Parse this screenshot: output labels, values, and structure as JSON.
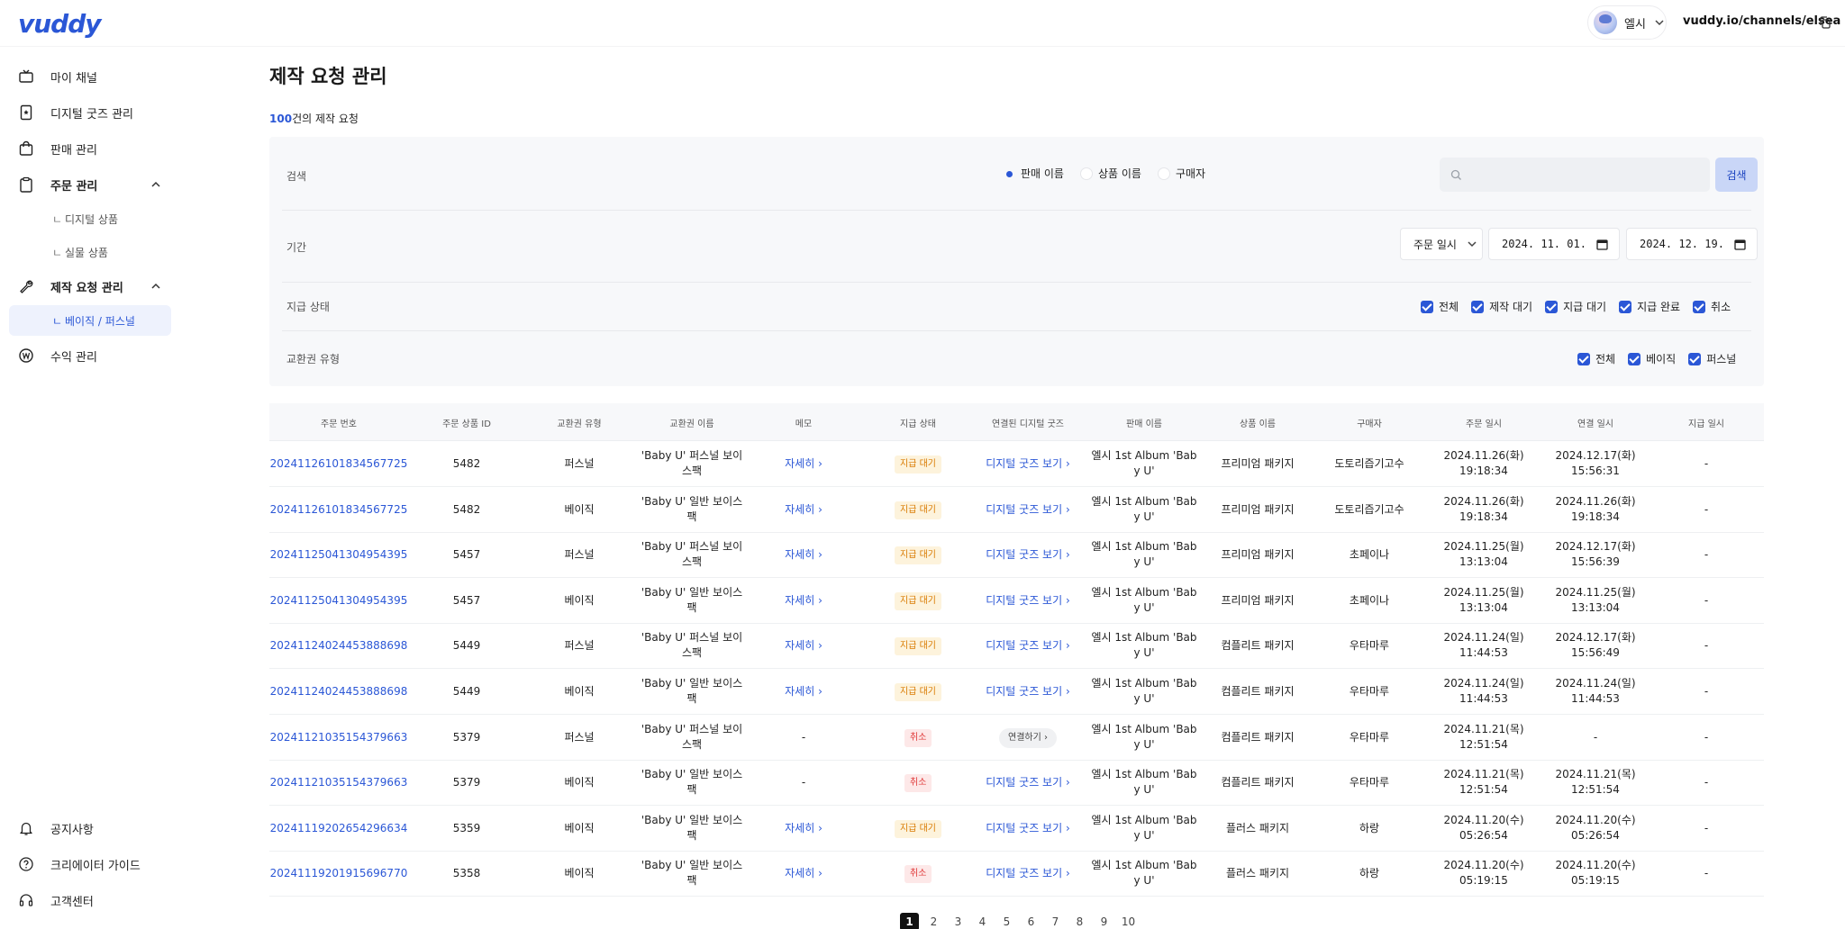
{
  "header": {
    "logo": "vuddy",
    "user_name": "엘시",
    "channel_url": "vuddy.io/channels/elsea"
  },
  "sidebar": {
    "items": [
      {
        "label": "마이 채널",
        "icon": "tv-icon"
      },
      {
        "label": "디지털 굿즈 관리",
        "icon": "digital-goods-icon"
      },
      {
        "label": "판매 관리",
        "icon": "shopping-bag-icon"
      },
      {
        "label": "주문 관리",
        "icon": "clipboard-icon"
      },
      {
        "label": "제작 요청 관리",
        "icon": "wrench-icon"
      },
      {
        "label": "수익 관리",
        "icon": "won-coin-icon"
      }
    ],
    "order_sub": [
      {
        "label": "디지털 상품"
      },
      {
        "label": "실물 상품"
      }
    ],
    "request_sub": [
      {
        "label": "베이직 / 퍼스널"
      }
    ],
    "bottom": [
      {
        "label": "공지사항",
        "icon": "bell-icon"
      },
      {
        "label": "크리에이터 가이드",
        "icon": "help-circle-icon"
      },
      {
        "label": "고객센터",
        "icon": "headset-icon"
      }
    ]
  },
  "page": {
    "title": "제작 요청 관리",
    "count_num": "100",
    "count_suffix": "건의 제작 요청"
  },
  "filters": {
    "search_label": "검색",
    "search_options": [
      "판매 이름",
      "상품 이름",
      "구매자"
    ],
    "search_selected": "판매 이름",
    "search_value": "",
    "search_button": "검색",
    "period_label": "기간",
    "period_type": "주문 일시",
    "date_from": "2024. 11. 01.",
    "date_to": "2024. 12. 19.",
    "pay_status_label": "지급 상태",
    "pay_status_options": [
      "전체",
      "제작 대기",
      "지급 대기",
      "지급 완료",
      "취소"
    ],
    "ticket_type_label": "교환권 유형",
    "ticket_type_options": [
      "전체",
      "베이직",
      "퍼스널"
    ]
  },
  "table": {
    "columns": [
      "주문 번호",
      "주문 상품 ID",
      "교환권 유형",
      "교환권 이름",
      "메모",
      "지급 상태",
      "연결된 디지털 굿즈",
      "판매 이름",
      "상품 이름",
      "구매자",
      "주문 일시",
      "연결 일시",
      "지급 일시"
    ],
    "memo_link": "자세히",
    "goods_link": "디지털 굿즈 보기",
    "connect_button": "연결하기",
    "rows": [
      {
        "order": "20241126101834567725",
        "pid": "5482",
        "type": "퍼스널",
        "name1": "'Baby U' 퍼스널 보이",
        "name2": "스팩",
        "memo": "link",
        "status": "지급 대기",
        "goods": "link",
        "sale1": "엘시 1st Album 'Bab",
        "sale2": "y U'",
        "product": "프리미엄 패키지",
        "buyer": "도토리즙기고수",
        "od1": "2024.11.26(화)",
        "od2": "19:18:34",
        "cd1": "2024.12.17(화)",
        "cd2": "15:56:31",
        "paid": "-"
      },
      {
        "order": "20241126101834567725",
        "pid": "5482",
        "type": "베이직",
        "name1": "'Baby U' 일반 보이스",
        "name2": "팩",
        "memo": "link",
        "status": "지급 대기",
        "goods": "link",
        "sale1": "엘시 1st Album 'Bab",
        "sale2": "y U'",
        "product": "프리미엄 패키지",
        "buyer": "도토리즙기고수",
        "od1": "2024.11.26(화)",
        "od2": "19:18:34",
        "cd1": "2024.11.26(화)",
        "cd2": "19:18:34",
        "paid": "-"
      },
      {
        "order": "20241125041304954395",
        "pid": "5457",
        "type": "퍼스널",
        "name1": "'Baby U' 퍼스널 보이",
        "name2": "스팩",
        "memo": "link",
        "status": "지급 대기",
        "goods": "link",
        "sale1": "엘시 1st Album 'Bab",
        "sale2": "y U'",
        "product": "프리미엄 패키지",
        "buyer": "초페이나",
        "od1": "2024.11.25(월)",
        "od2": "13:13:04",
        "cd1": "2024.12.17(화)",
        "cd2": "15:56:39",
        "paid": "-"
      },
      {
        "order": "20241125041304954395",
        "pid": "5457",
        "type": "베이직",
        "name1": "'Baby U' 일반 보이스",
        "name2": "팩",
        "memo": "link",
        "status": "지급 대기",
        "goods": "link",
        "sale1": "엘시 1st Album 'Bab",
        "sale2": "y U'",
        "product": "프리미엄 패키지",
        "buyer": "초페이나",
        "od1": "2024.11.25(월)",
        "od2": "13:13:04",
        "cd1": "2024.11.25(월)",
        "cd2": "13:13:04",
        "paid": "-"
      },
      {
        "order": "20241124024453888698",
        "pid": "5449",
        "type": "퍼스널",
        "name1": "'Baby U' 퍼스널 보이",
        "name2": "스팩",
        "memo": "link",
        "status": "지급 대기",
        "goods": "link",
        "sale1": "엘시 1st Album 'Bab",
        "sale2": "y U'",
        "product": "컴플리트 패키지",
        "buyer": "우타마루",
        "od1": "2024.11.24(일)",
        "od2": "11:44:53",
        "cd1": "2024.12.17(화)",
        "cd2": "15:56:49",
        "paid": "-"
      },
      {
        "order": "20241124024453888698",
        "pid": "5449",
        "type": "베이직",
        "name1": "'Baby U' 일반 보이스",
        "name2": "팩",
        "memo": "link",
        "status": "지급 대기",
        "goods": "link",
        "sale1": "엘시 1st Album 'Bab",
        "sale2": "y U'",
        "product": "컴플리트 패키지",
        "buyer": "우타마루",
        "od1": "2024.11.24(일)",
        "od2": "11:44:53",
        "cd1": "2024.11.24(일)",
        "cd2": "11:44:53",
        "paid": "-"
      },
      {
        "order": "20241121035154379663",
        "pid": "5379",
        "type": "퍼스널",
        "name1": "'Baby U' 퍼스널 보이",
        "name2": "스팩",
        "memo": "-",
        "status": "취소",
        "goods": "connect",
        "sale1": "엘시 1st Album 'Bab",
        "sale2": "y U'",
        "product": "컴플리트 패키지",
        "buyer": "우타마루",
        "od1": "2024.11.21(목)",
        "od2": "12:51:54",
        "cd1": "-",
        "cd2": "",
        "paid": "-"
      },
      {
        "order": "20241121035154379663",
        "pid": "5379",
        "type": "베이직",
        "name1": "'Baby U' 일반 보이스",
        "name2": "팩",
        "memo": "-",
        "status": "취소",
        "goods": "link",
        "sale1": "엘시 1st Album 'Bab",
        "sale2": "y U'",
        "product": "컴플리트 패키지",
        "buyer": "우타마루",
        "od1": "2024.11.21(목)",
        "od2": "12:51:54",
        "cd1": "2024.11.21(목)",
        "cd2": "12:51:54",
        "paid": "-"
      },
      {
        "order": "20241119202654296634",
        "pid": "5359",
        "type": "베이직",
        "name1": "'Baby U' 일반 보이스",
        "name2": "팩",
        "memo": "link",
        "status": "지급 대기",
        "goods": "link",
        "sale1": "엘시 1st Album 'Bab",
        "sale2": "y U'",
        "product": "플러스 패키지",
        "buyer": "하랑",
        "od1": "2024.11.20(수)",
        "od2": "05:26:54",
        "cd1": "2024.11.20(수)",
        "cd2": "05:26:54",
        "paid": "-"
      },
      {
        "order": "20241119201915696770",
        "pid": "5358",
        "type": "베이직",
        "name1": "'Baby U' 일반 보이스",
        "name2": "팩",
        "memo": "link",
        "status": "취소",
        "goods": "link",
        "sale1": "엘시 1st Album 'Bab",
        "sale2": "y U'",
        "product": "플러스 패키지",
        "buyer": "하랑",
        "od1": "2024.11.20(수)",
        "od2": "05:19:15",
        "cd1": "2024.11.20(수)",
        "cd2": "05:19:15",
        "paid": "-"
      }
    ]
  },
  "pagination": {
    "pages": [
      "1",
      "2",
      "3",
      "4",
      "5",
      "6",
      "7",
      "8",
      "9",
      "10"
    ],
    "current": "1"
  },
  "colors": {
    "accent": "#2b57d6",
    "wait_badge": "#d97a00",
    "cancel_badge": "#e03a3a"
  }
}
